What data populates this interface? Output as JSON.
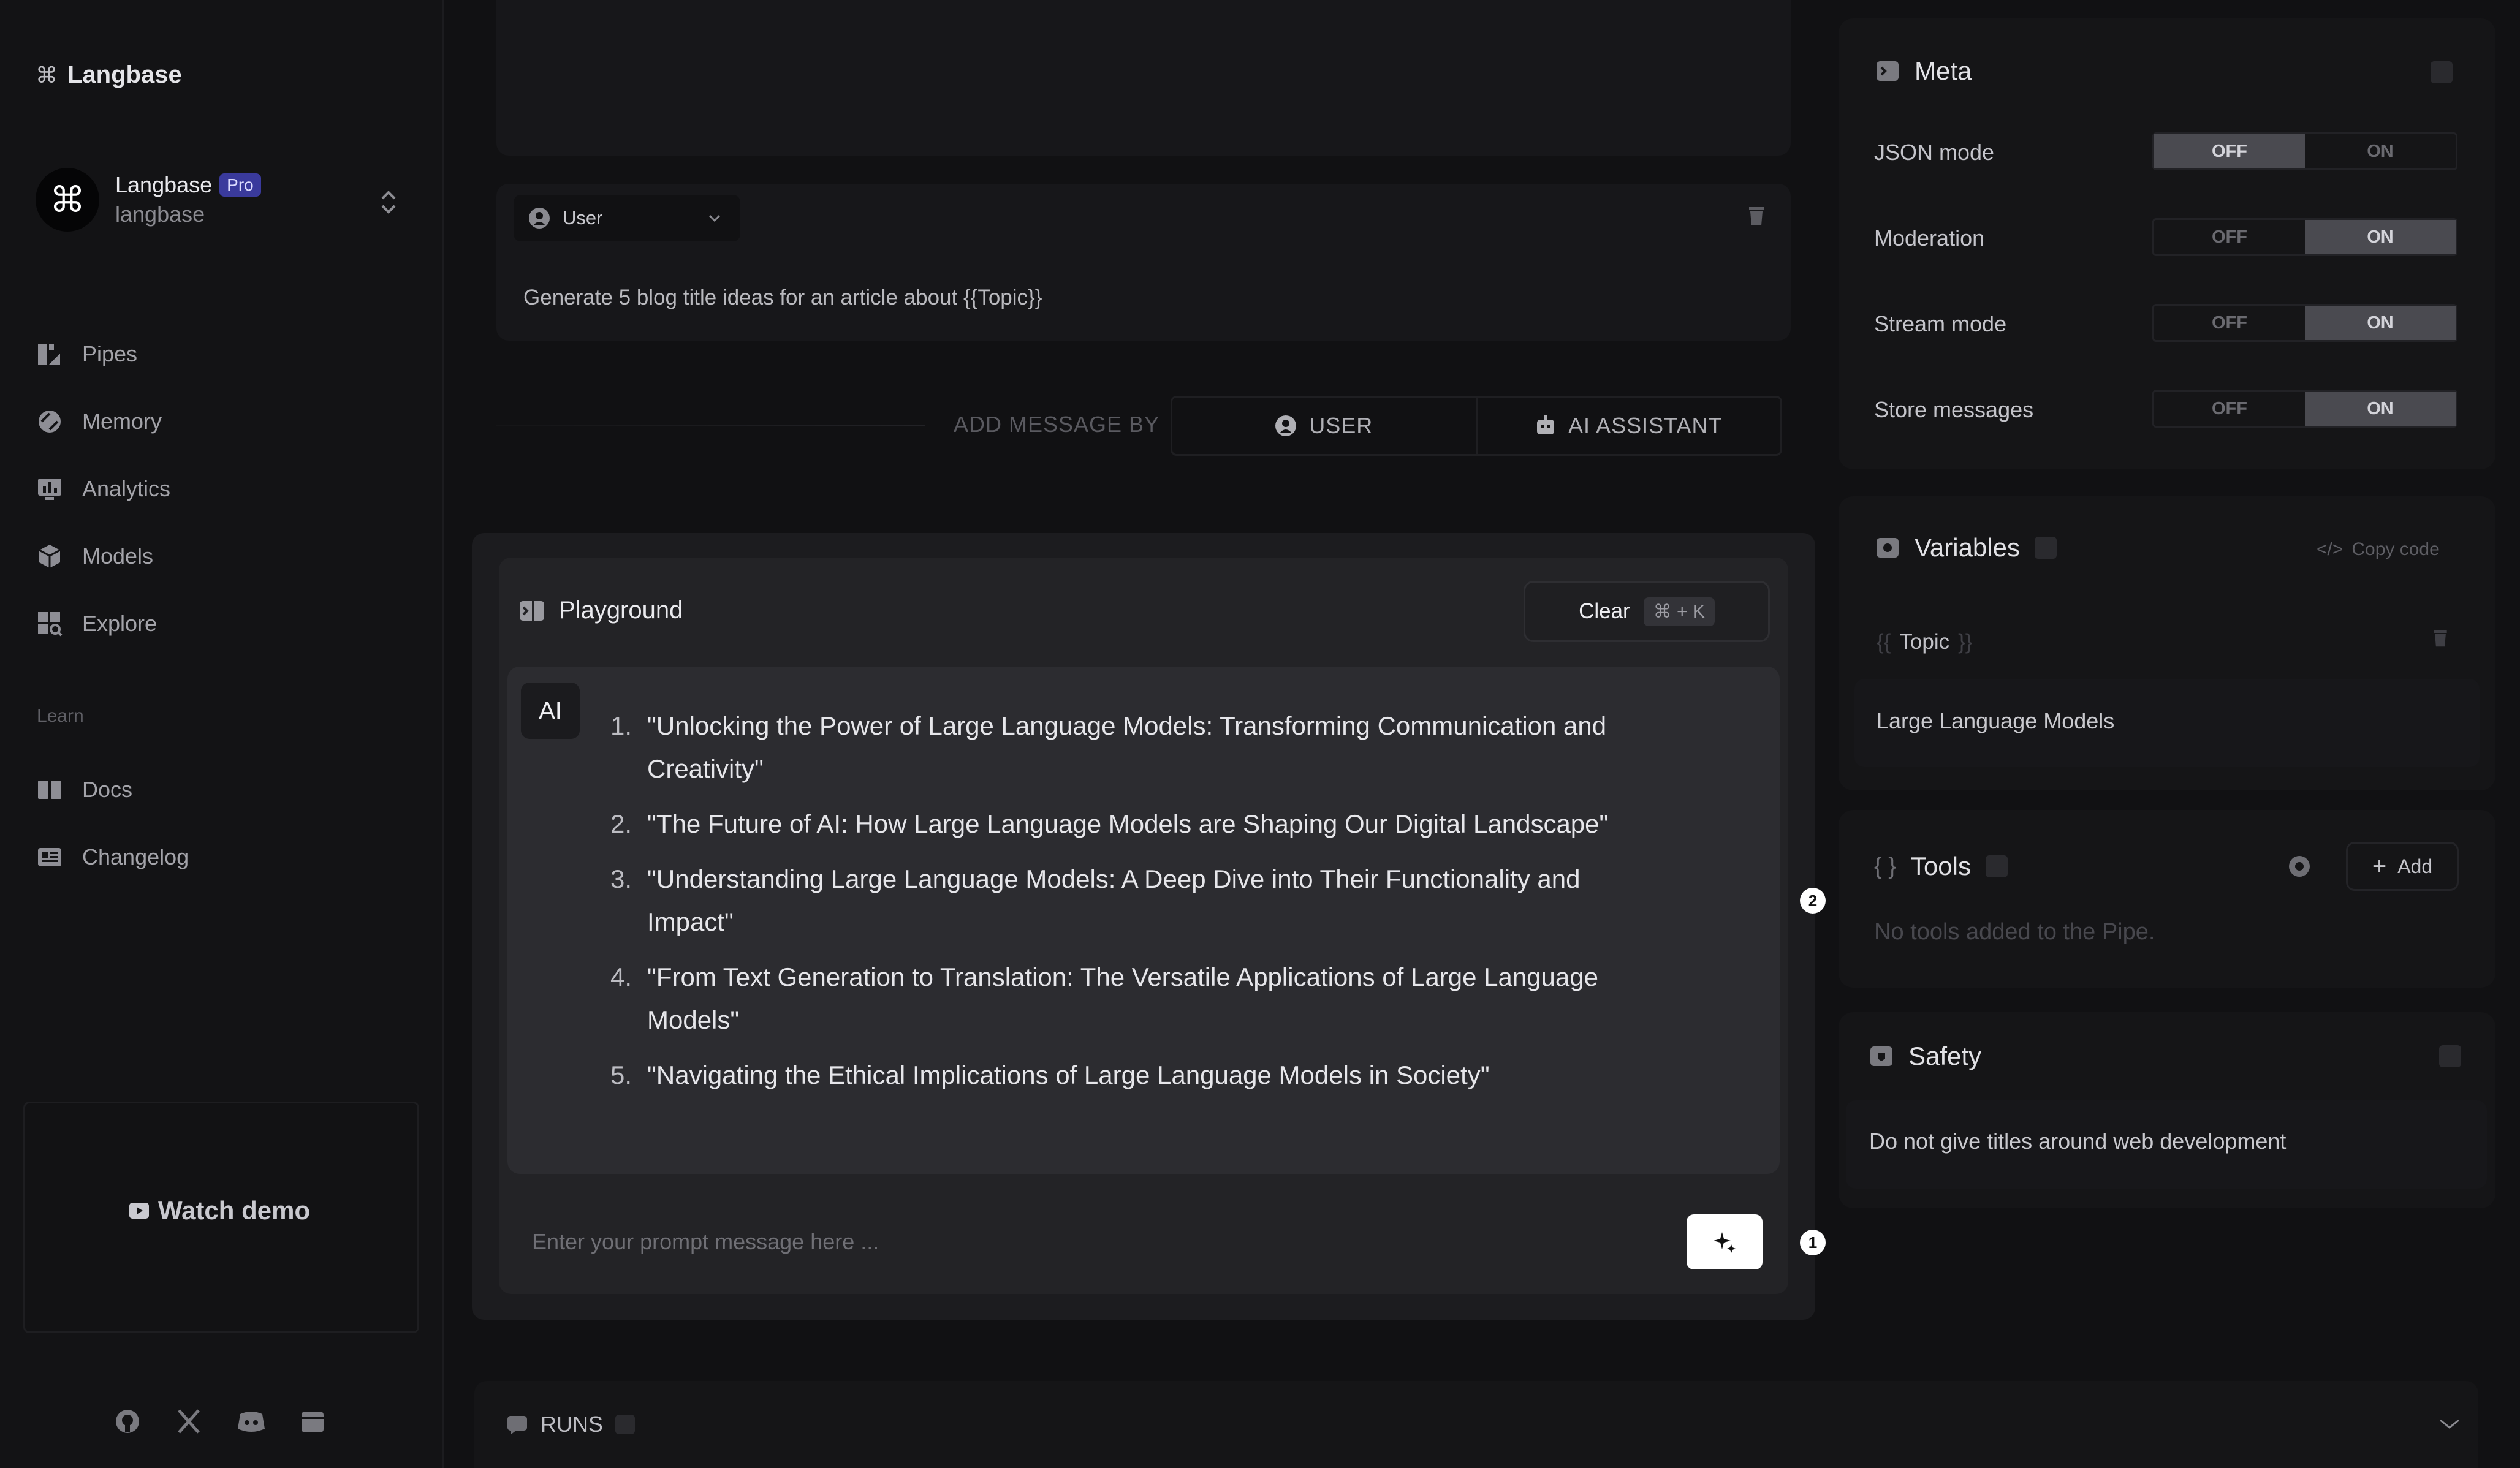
{
  "sidebar": {
    "brand": "Langbase",
    "account": {
      "name": "Langbase",
      "plan": "Pro",
      "handle": "langbase"
    },
    "nav": [
      "Pipes",
      "Memory",
      "Analytics",
      "Models",
      "Explore"
    ],
    "learn_heading": "Learn",
    "learn_items": [
      "Docs",
      "Changelog"
    ],
    "watch_demo": "Watch demo"
  },
  "editor": {
    "role": "User",
    "message": "Generate 5 blog title ideas for an article about {{Topic}}",
    "add_message_by": "ADD MESSAGE BY",
    "add_user": "USER",
    "add_assistant": "AI ASSISTANT"
  },
  "playground": {
    "title": "Playground",
    "clear_label": "Clear",
    "clear_shortcut": "⌘ + K",
    "ai_badge": "AI",
    "answer": [
      {
        "num": "1.",
        "text": "\"Unlocking the Power of Large Language Models: Transforming Communication and Creativity\""
      },
      {
        "num": "2.",
        "text": "\"The Future of AI: How Large Language Models are Shaping Our Digital Landscape\""
      },
      {
        "num": "3.",
        "text": "\"Understanding Large Language Models: A Deep Dive into Their Functionality and Impact\""
      },
      {
        "num": "4.",
        "text": "\"From Text Generation to Translation: The Versatile Applications of Large Language Models\""
      },
      {
        "num": "5.",
        "text": "\"Navigating the Ethical Implications of Large Language Models in Society\""
      }
    ],
    "prompt_placeholder": "Enter your prompt message here ...",
    "marker_1": "1",
    "marker_2": "2"
  },
  "runs": {
    "label": "RUNS"
  },
  "meta": {
    "title": "Meta",
    "rows": [
      {
        "label": "JSON mode",
        "off": "OFF",
        "on": "ON",
        "state": "off"
      },
      {
        "label": "Moderation",
        "off": "OFF",
        "on": "ON",
        "state": "on"
      },
      {
        "label": "Stream mode",
        "off": "OFF",
        "on": "ON",
        "state": "on"
      },
      {
        "label": "Store messages",
        "off": "OFF",
        "on": "ON",
        "state": "on"
      }
    ]
  },
  "variables": {
    "title": "Variables",
    "copy_code": "Copy code",
    "open_brace": "{{",
    "close_brace": "}}",
    "name": "Topic",
    "value": "Large Language Models"
  },
  "tools": {
    "title": "Tools",
    "add_label": "Add",
    "empty": "No tools added to the Pipe."
  },
  "safety": {
    "title": "Safety",
    "value": "Do not give titles around web development"
  },
  "colors": {
    "accent_badge": "#3a3a9c",
    "toggle_on": "#4a4a50"
  }
}
